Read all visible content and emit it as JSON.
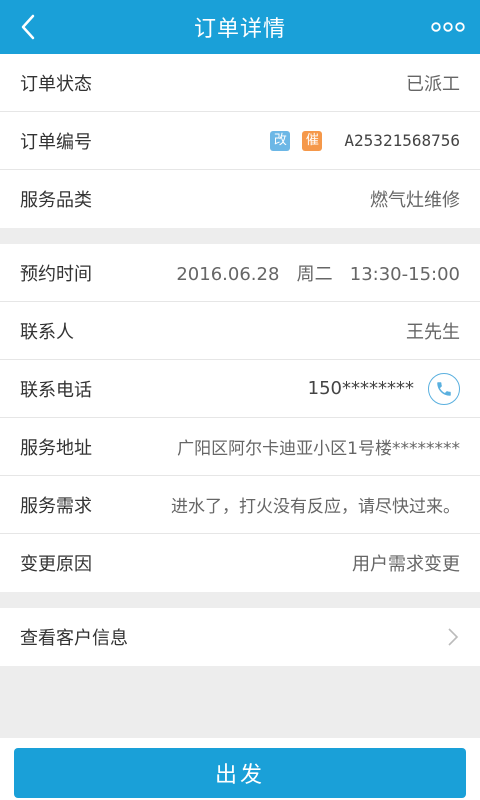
{
  "header": {
    "title": "订单详情",
    "back_icon": "back-arrow-icon",
    "more_icon": "more-dots-icon"
  },
  "order": {
    "status_label": "订单状态",
    "status_value": "已派工",
    "number_label": "订单编号",
    "badge_1": "改",
    "badge_2": "催",
    "number_value": "A25321568756",
    "category_label": "服务品类",
    "category_value": "燃气灶维修"
  },
  "appointment": {
    "time_label": "预约时间",
    "time_value": "2016.06.28   周二   13:30-15:00",
    "contact_label": "联系人",
    "contact_value": "王先生",
    "phone_label": "联系电话",
    "phone_value": "150********",
    "address_label": "服务地址",
    "address_value": "广阳区阿尔卡迪亚小区1号楼********",
    "need_label": "服务需求",
    "need_value": "进水了，打火没有反应，请尽快过来。",
    "reason_label": "变更原因",
    "reason_value": "用户需求变更"
  },
  "customer": {
    "view_label": "查看客户信息"
  },
  "footer": {
    "go_label": "出发"
  },
  "colors": {
    "primary": "#1aa0d8",
    "badge_blue": "#6cb7e6",
    "badge_orange": "#f5984a"
  }
}
